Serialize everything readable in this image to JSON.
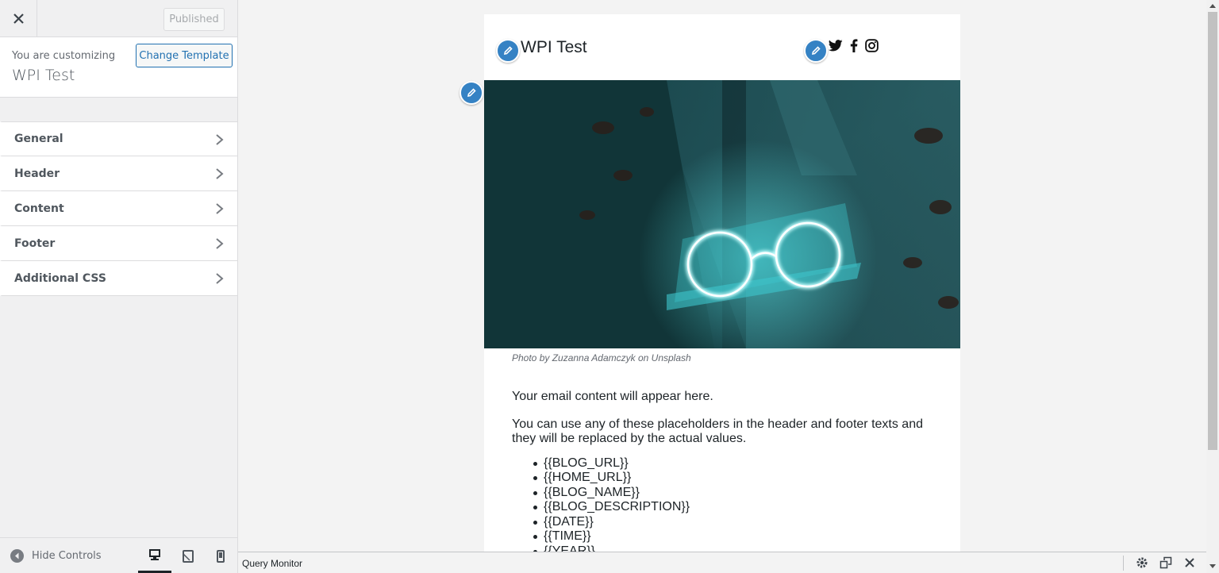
{
  "sidebar": {
    "close_icon": "close-icon",
    "published_label": "Published",
    "customizing_label": "You are customizing",
    "site_name": "WPI Test",
    "change_template_label": "Change Template",
    "sections": [
      {
        "label": "General"
      },
      {
        "label": "Header"
      },
      {
        "label": "Content"
      },
      {
        "label": "Footer"
      },
      {
        "label": "Additional CSS"
      }
    ],
    "hide_controls_label": "Hide Controls",
    "devices": [
      "desktop-icon",
      "tablet-icon",
      "mobile-icon"
    ],
    "active_device": "desktop"
  },
  "email": {
    "title": "WPI Test",
    "social_icons": [
      "twitter-icon",
      "facebook-icon",
      "instagram-icon"
    ],
    "caption": "Photo by Zuzanna Adamczyk on Unsplash",
    "intro": "Your email content will appear here.",
    "placeholders_intro": "You can use any of these placeholders in the header and footer texts and they will be replaced by the actual values.",
    "placeholders": [
      "{{BLOG_URL}}",
      "{{HOME_URL}}",
      "{{BLOG_NAME}}",
      "{{BLOG_DESCRIPTION}}",
      "{{DATE}}",
      "{{TIME}}",
      "{{YEAR}}"
    ]
  },
  "query_monitor": {
    "title": "Query Monitor"
  },
  "colors": {
    "accent": "#2271b1",
    "pencil": "#3582c4",
    "neon": "#4fe0e6"
  }
}
